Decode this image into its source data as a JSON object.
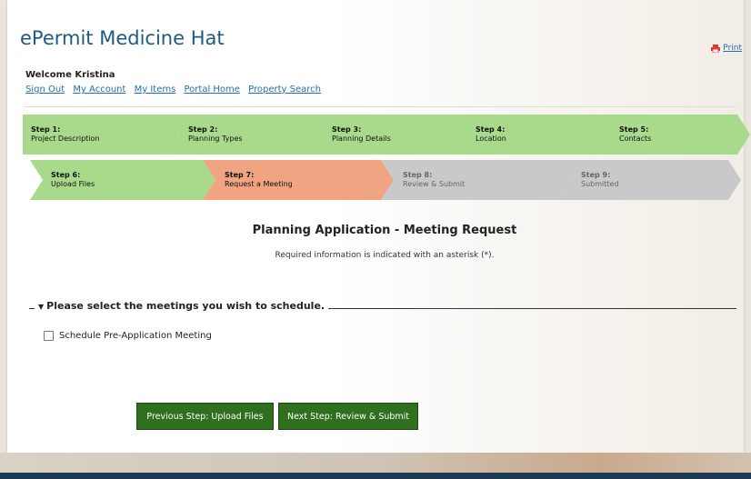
{
  "header": {
    "site_title": "ePermit Medicine Hat",
    "print_label": "Print",
    "welcome": "Welcome Kristina"
  },
  "nav": {
    "links": [
      "Sign Out",
      "My Account",
      "My Items",
      "Portal Home",
      "Property Search"
    ]
  },
  "steps": [
    {
      "num": "Step 1:",
      "label": "Project Description",
      "status": "done"
    },
    {
      "num": "Step 2:",
      "label": "Planning Types",
      "status": "done"
    },
    {
      "num": "Step 3:",
      "label": "Planning Details",
      "status": "done"
    },
    {
      "num": "Step 4:",
      "label": "Location",
      "status": "done"
    },
    {
      "num": "Step 5:",
      "label": "Contacts",
      "status": "done"
    },
    {
      "num": "Step 6:",
      "label": "Upload Files",
      "status": "done"
    },
    {
      "num": "Step 7:",
      "label": "Request a Meeting",
      "status": "current"
    },
    {
      "num": "Step 8:",
      "label": "Review & Submit",
      "status": "todo"
    },
    {
      "num": "Step 9:",
      "label": "Submitted",
      "status": "todo"
    }
  ],
  "main": {
    "title": "Planning Application - Meeting Request",
    "required_note": "Required information is indicated with an asterisk (*).",
    "legend": "Please select the meetings you wish to schedule.",
    "checkbox_label": "Schedule Pre-Application Meeting",
    "checkbox_checked": false
  },
  "buttons": {
    "prev": "Previous Step: Upload Files",
    "next": "Next Step: Review & Submit"
  },
  "colors": {
    "step_done": "#a9d98a",
    "step_current": "#f0a482",
    "step_todo": "#c9c9c9",
    "button": "#2f6f1e",
    "link": "#1f6fb2",
    "title": "#1f5a80"
  }
}
